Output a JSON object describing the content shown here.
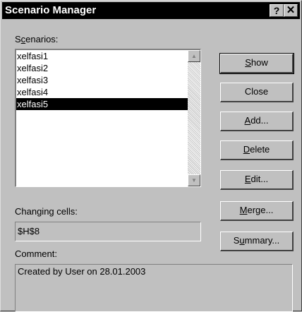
{
  "window": {
    "title": "Scenario Manager",
    "help_button": "?",
    "close_button": "✕"
  },
  "scenarios": {
    "label_pre": "S",
    "label_key": "c",
    "label_post": "enarios:",
    "items": [
      "xelfasi1",
      "xelfasi2",
      "xelfasi3",
      "xelfasi4",
      "xelfasi5"
    ],
    "selected_index": 4
  },
  "buttons": {
    "show": {
      "pre": "",
      "key": "S",
      "post": "how"
    },
    "close": "Close",
    "add": {
      "pre": "",
      "key": "A",
      "post": "dd..."
    },
    "delete": {
      "pre": "",
      "key": "D",
      "post": "elete"
    },
    "edit": {
      "pre": "",
      "key": "E",
      "post": "dit..."
    },
    "merge": {
      "pre": "",
      "key": "M",
      "post": "erge..."
    },
    "summary": {
      "pre": "S",
      "key": "u",
      "post": "mmary..."
    }
  },
  "changing_cells": {
    "label": "Changing cells:",
    "value": "$H$8"
  },
  "comment": {
    "label": "Comment:",
    "value": "Created by User on 28.01.2003"
  }
}
